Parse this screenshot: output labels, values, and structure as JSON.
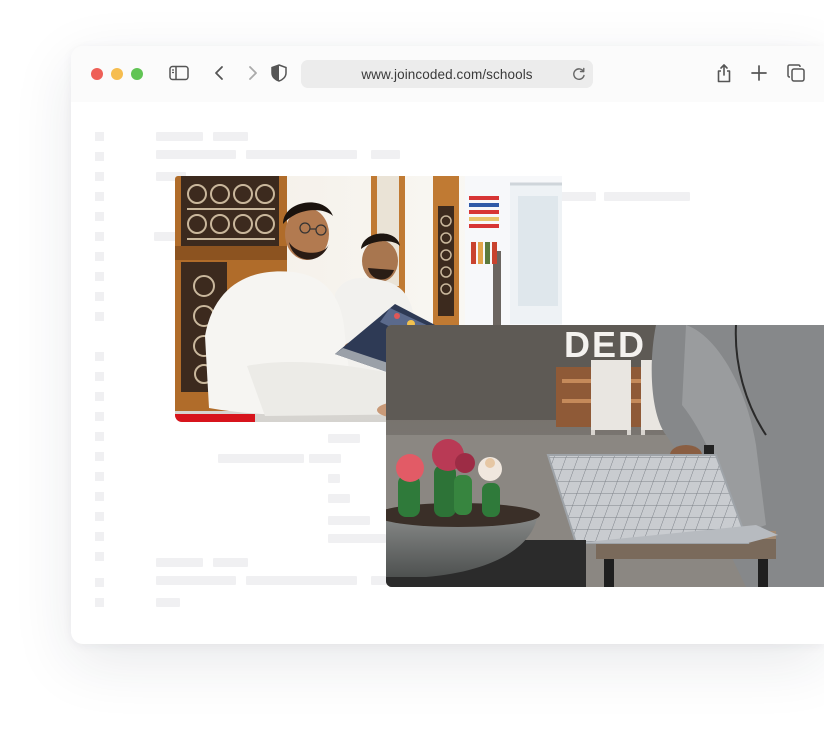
{
  "browser": {
    "url": "www.joincoded.com/schools",
    "icons": {
      "close": "red-close-dot",
      "minimize": "yellow-minimize-dot",
      "zoom": "green-zoom-dot",
      "sidebar": "sidebar-icon",
      "back": "chevron-left-icon",
      "forward": "chevron-right-icon",
      "privacy": "shield-icon",
      "reload": "reload-icon",
      "share": "share-icon",
      "new_tab": "plus-icon",
      "tabs": "tabs-overview-icon"
    }
  },
  "photos": [
    {
      "name": "two-men-with-laptop-photo",
      "sign_text": ""
    },
    {
      "name": "cactus-and-laptop-photo",
      "sign_text": "DED"
    }
  ],
  "colors": {
    "accent_red": "#d7141c",
    "window_bg": "#ffffff",
    "toolbar_bg": "#fbfbfb",
    "address_bg": "#ececec",
    "skeleton": "#f0f0f2"
  }
}
